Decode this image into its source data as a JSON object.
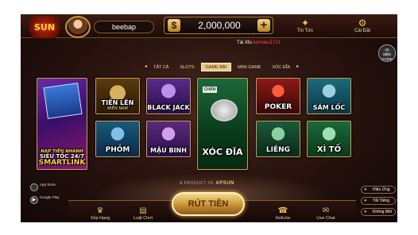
{
  "header": {
    "logo_text": "SUN",
    "username": "beebap",
    "balance": "2,000,000",
    "currency_symbol": "$",
    "news_label": "Tin Tức",
    "settings_label": "Cài Đặt"
  },
  "ticker": {
    "prefix": "Tài Xỉu",
    "user": "kemdau1721"
  },
  "mini_game": {
    "label": "MINI GAME",
    "count": "44"
  },
  "filter_tabs": [
    "TẤT CẢ",
    "SLOTS",
    "GAME BÀI",
    "MINI GAME",
    "XÓC ĐĨA"
  ],
  "active_tab": "GAME BÀI",
  "games": {
    "smartlink": {
      "line1": "NẠP TIỀN NHANH",
      "line2": "SIÊU TỐC 24/7",
      "line3": "SMARTLINK"
    },
    "tien_len": {
      "title": "TIẾN LÊN",
      "sub": "MIỀN NAM"
    },
    "black_jack": {
      "title": "BLACK JACK"
    },
    "xoc_dia": {
      "title": "XÓC ĐĨA",
      "badge": "CHẴN"
    },
    "poker": {
      "title": "POKER"
    },
    "sam_loc": {
      "title": "SÂM LỐC"
    },
    "phom": {
      "title": "PHỎM"
    },
    "mau_binh": {
      "title": "MẬU BINH"
    },
    "lieng": {
      "title": "LIÊNG"
    },
    "xi_to": {
      "title": "XÌ TỐ"
    }
  },
  "product": {
    "prefix": "A PRODUCT OF",
    "brand": "APSUN"
  },
  "stores": {
    "app_store": "App Store",
    "google_play": "Google Play"
  },
  "options": {
    "effects": "Hiệu Ứng",
    "sound": "Tắt Tiếng",
    "music": "Không Mời"
  },
  "bottom": {
    "ranking": "Xếp Hạng",
    "history": "Luật Chơi",
    "withdraw": "RÚT TIỀN",
    "hotline": "HotLine",
    "live_chat": "Live Chat"
  },
  "colors": {
    "accent_gold": "#c9952a",
    "ticker_highlight": "#ff4a3a"
  }
}
